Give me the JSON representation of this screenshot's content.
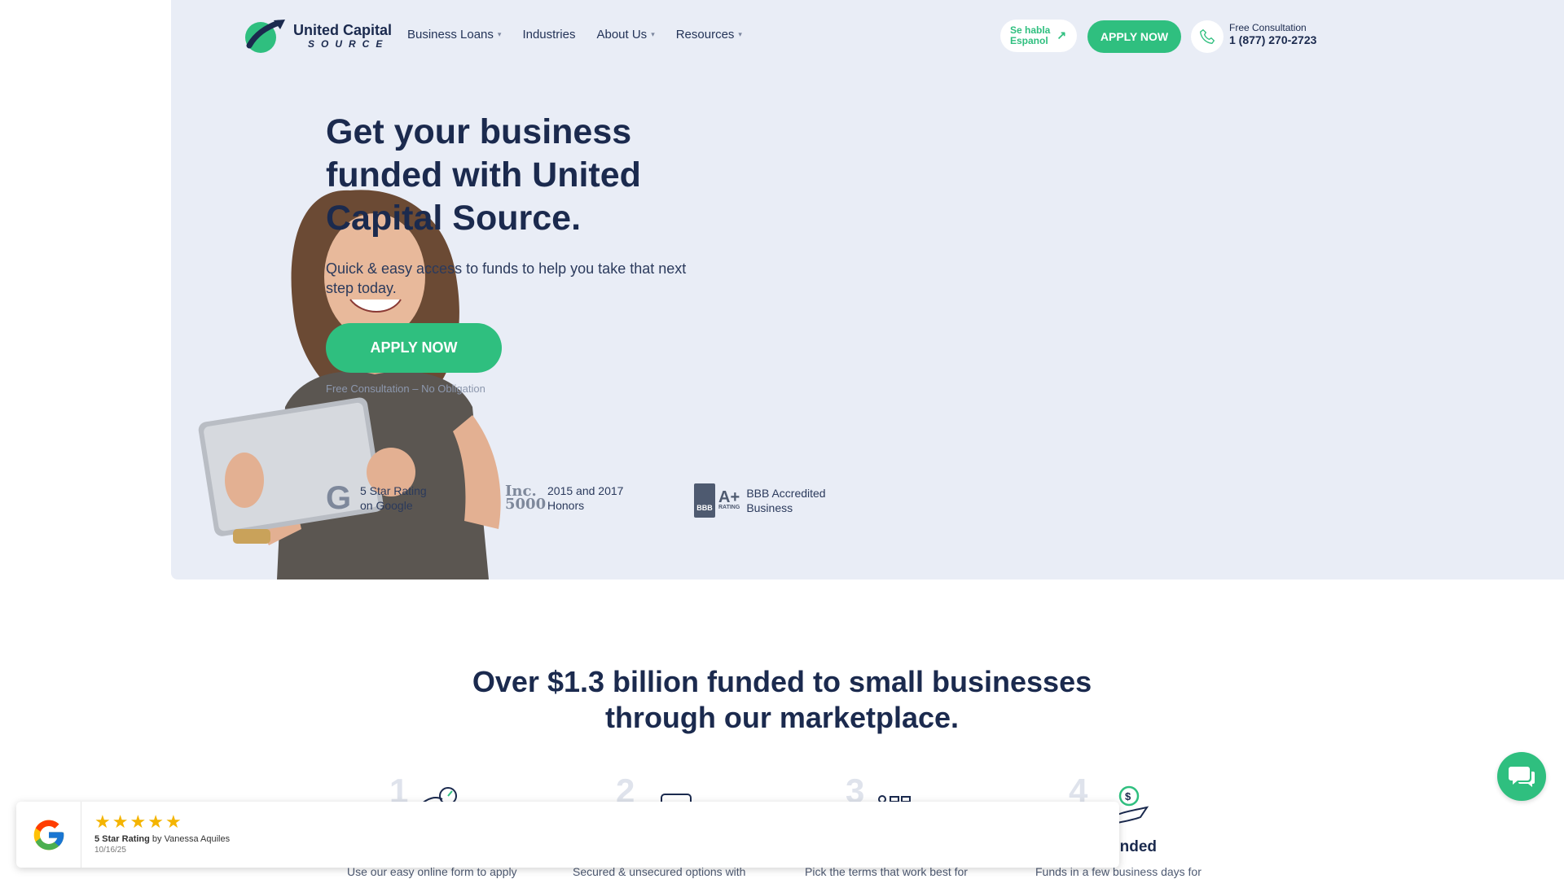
{
  "colors": {
    "accent": "#2fbf7f",
    "navy": "#1b2a4e",
    "hero_bg": "#e9edf6"
  },
  "header": {
    "logo": {
      "name": "United Capital",
      "sub": "SOURCE"
    },
    "nav": [
      {
        "label": "Business Loans",
        "has_dropdown": true
      },
      {
        "label": "Industries",
        "has_dropdown": false
      },
      {
        "label": "About Us",
        "has_dropdown": true
      },
      {
        "label": "Resources",
        "has_dropdown": true
      }
    ],
    "habla_line1": "Se habla",
    "habla_line2": "Espanol",
    "apply_label": "APPLY NOW",
    "consult_label": "Free Consultation",
    "phone": "1 (877) 270-2723"
  },
  "hero": {
    "title": "Get your business funded with United Capital Source.",
    "subtitle": "Quick & easy access to funds to help you take that next step today.",
    "cta": "APPLY NOW",
    "note": "Free Consultation – No Obligation",
    "badges": [
      {
        "icon": "google-icon",
        "line1": "5 Star Rating",
        "line2": "on Google"
      },
      {
        "icon": "inc5000-icon",
        "line1": "2015 and 2017",
        "line2": "Honors"
      },
      {
        "icon": "bbb-icon",
        "line1": "BBB Accredited",
        "line2": "Business"
      }
    ],
    "inc_logo": "Inc. 5000",
    "bbb_label": "BBB",
    "bbb_grade": "A+",
    "bbb_rating": "RATING"
  },
  "funded": {
    "title_line1": "Over $1.3 billion funded to small businesses",
    "title_line2": "through our marketplace."
  },
  "steps": [
    {
      "num": "1",
      "desc": "Use our easy online form to apply"
    },
    {
      "num": "2",
      "desc": "Secured & unsecured options with"
    },
    {
      "num": "3",
      "desc": "Pick the terms that work best for"
    },
    {
      "num": "4",
      "title": "unded",
      "desc": "Funds in a few business days for"
    }
  ],
  "review": {
    "stars": 5,
    "rating_label": "5 Star Rating",
    "by": "by Vanessa Aquiles",
    "date": "10/16/25"
  }
}
